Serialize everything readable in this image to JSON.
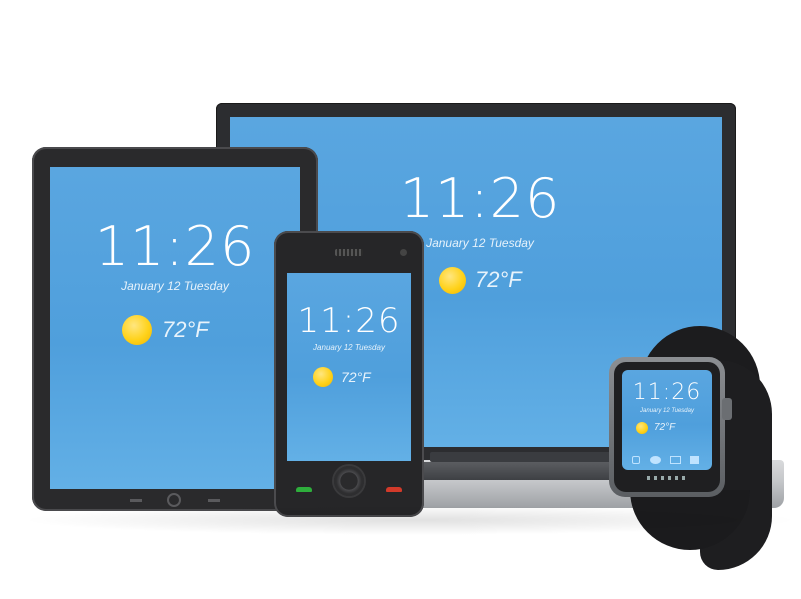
{
  "devices": {
    "laptop": {
      "time": "11:26",
      "date": "January 12 Tuesday",
      "temp": "72°F"
    },
    "tablet": {
      "time": "11:26",
      "date": "January 12 Tuesday",
      "temp": "72°F"
    },
    "phone": {
      "time": "11:26",
      "date": "January 12 Tuesday",
      "temp": "72°F"
    },
    "watch": {
      "time": "11:26",
      "date": "January 12 Tuesday",
      "temp": "72°F"
    }
  },
  "colors": {
    "screen": "#4f9fdc",
    "bezel": "#2b2b2d",
    "sun": "#ffd21a"
  }
}
